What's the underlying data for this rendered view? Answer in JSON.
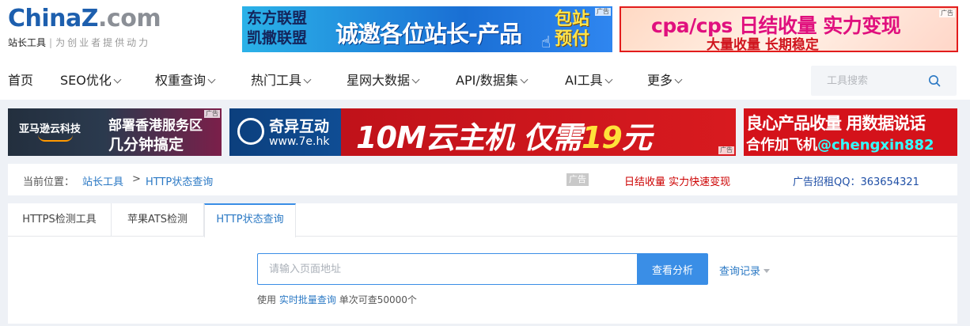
{
  "logo": {
    "part1": "China",
    "part2": "Z",
    "part3": ".com",
    "name": "站长工具",
    "slogan": "为创业者提供动力"
  },
  "ads_top": [
    {
      "left_line1": "东方联盟",
      "left_line2": "凯撒联盟",
      "headline": "诚邀各位站长-产品",
      "right_line1": "包站",
      "right_line2": "预付",
      "tag": "广告"
    },
    {
      "line1": "cpa/cps 日结收量 实力变现",
      "line2": "大量收量 长期稳定",
      "tag": "广告"
    }
  ],
  "nav": {
    "items": [
      {
        "label": "首页",
        "has_caret": false
      },
      {
        "label": "SEO优化",
        "has_caret": true
      },
      {
        "label": "权重查询",
        "has_caret": true
      },
      {
        "label": "热门工具",
        "has_caret": true
      },
      {
        "label": "星网大数据",
        "has_caret": true
      },
      {
        "label": "API/数据集",
        "has_caret": true
      },
      {
        "label": "AI工具",
        "has_caret": true
      },
      {
        "label": "更多",
        "has_caret": true
      }
    ],
    "search_placeholder": "工具搜索"
  },
  "ads_banner": [
    {
      "brand": "亚马逊云科技",
      "line1": "部署香港服务区",
      "line2": "几分钟搞定",
      "tag": "广告"
    },
    {
      "brand_name": "奇异互动",
      "brand_url": "www.7e.hk",
      "headline_a": "10M云主机  仅需",
      "headline_b": "19",
      "headline_c": "元",
      "tag": "广告"
    },
    {
      "line1": "良心产品收量 用数据说话",
      "line2_a": "合作加飞机",
      "line2_b": "@chengxin882"
    }
  ],
  "breadcrumb": {
    "label": "当前位置：",
    "link1": "站长工具",
    "separator": ">",
    "link2": "HTTP状态查询",
    "ad_badge": "广告",
    "ad_text": "日结收量 实力快速变现",
    "contact": "广告招租QQ：363654321"
  },
  "tabs": [
    {
      "label": "HTTPS检测工具",
      "active": false
    },
    {
      "label": "苹果ATS检测",
      "active": false
    },
    {
      "label": "HTTP状态查询",
      "active": true
    }
  ],
  "query": {
    "placeholder": "请输入页面地址",
    "value": "",
    "button_label": "查看分析",
    "history_label": "查询记录"
  },
  "hint": {
    "prefix": "使用",
    "link": "实时批量查询",
    "suffix": "单次可查50000个"
  },
  "colors": {
    "brand_blue": "#1d5fae",
    "accent": "#3a8ee6",
    "link": "#2a78c4",
    "ad_red": "#c00"
  }
}
